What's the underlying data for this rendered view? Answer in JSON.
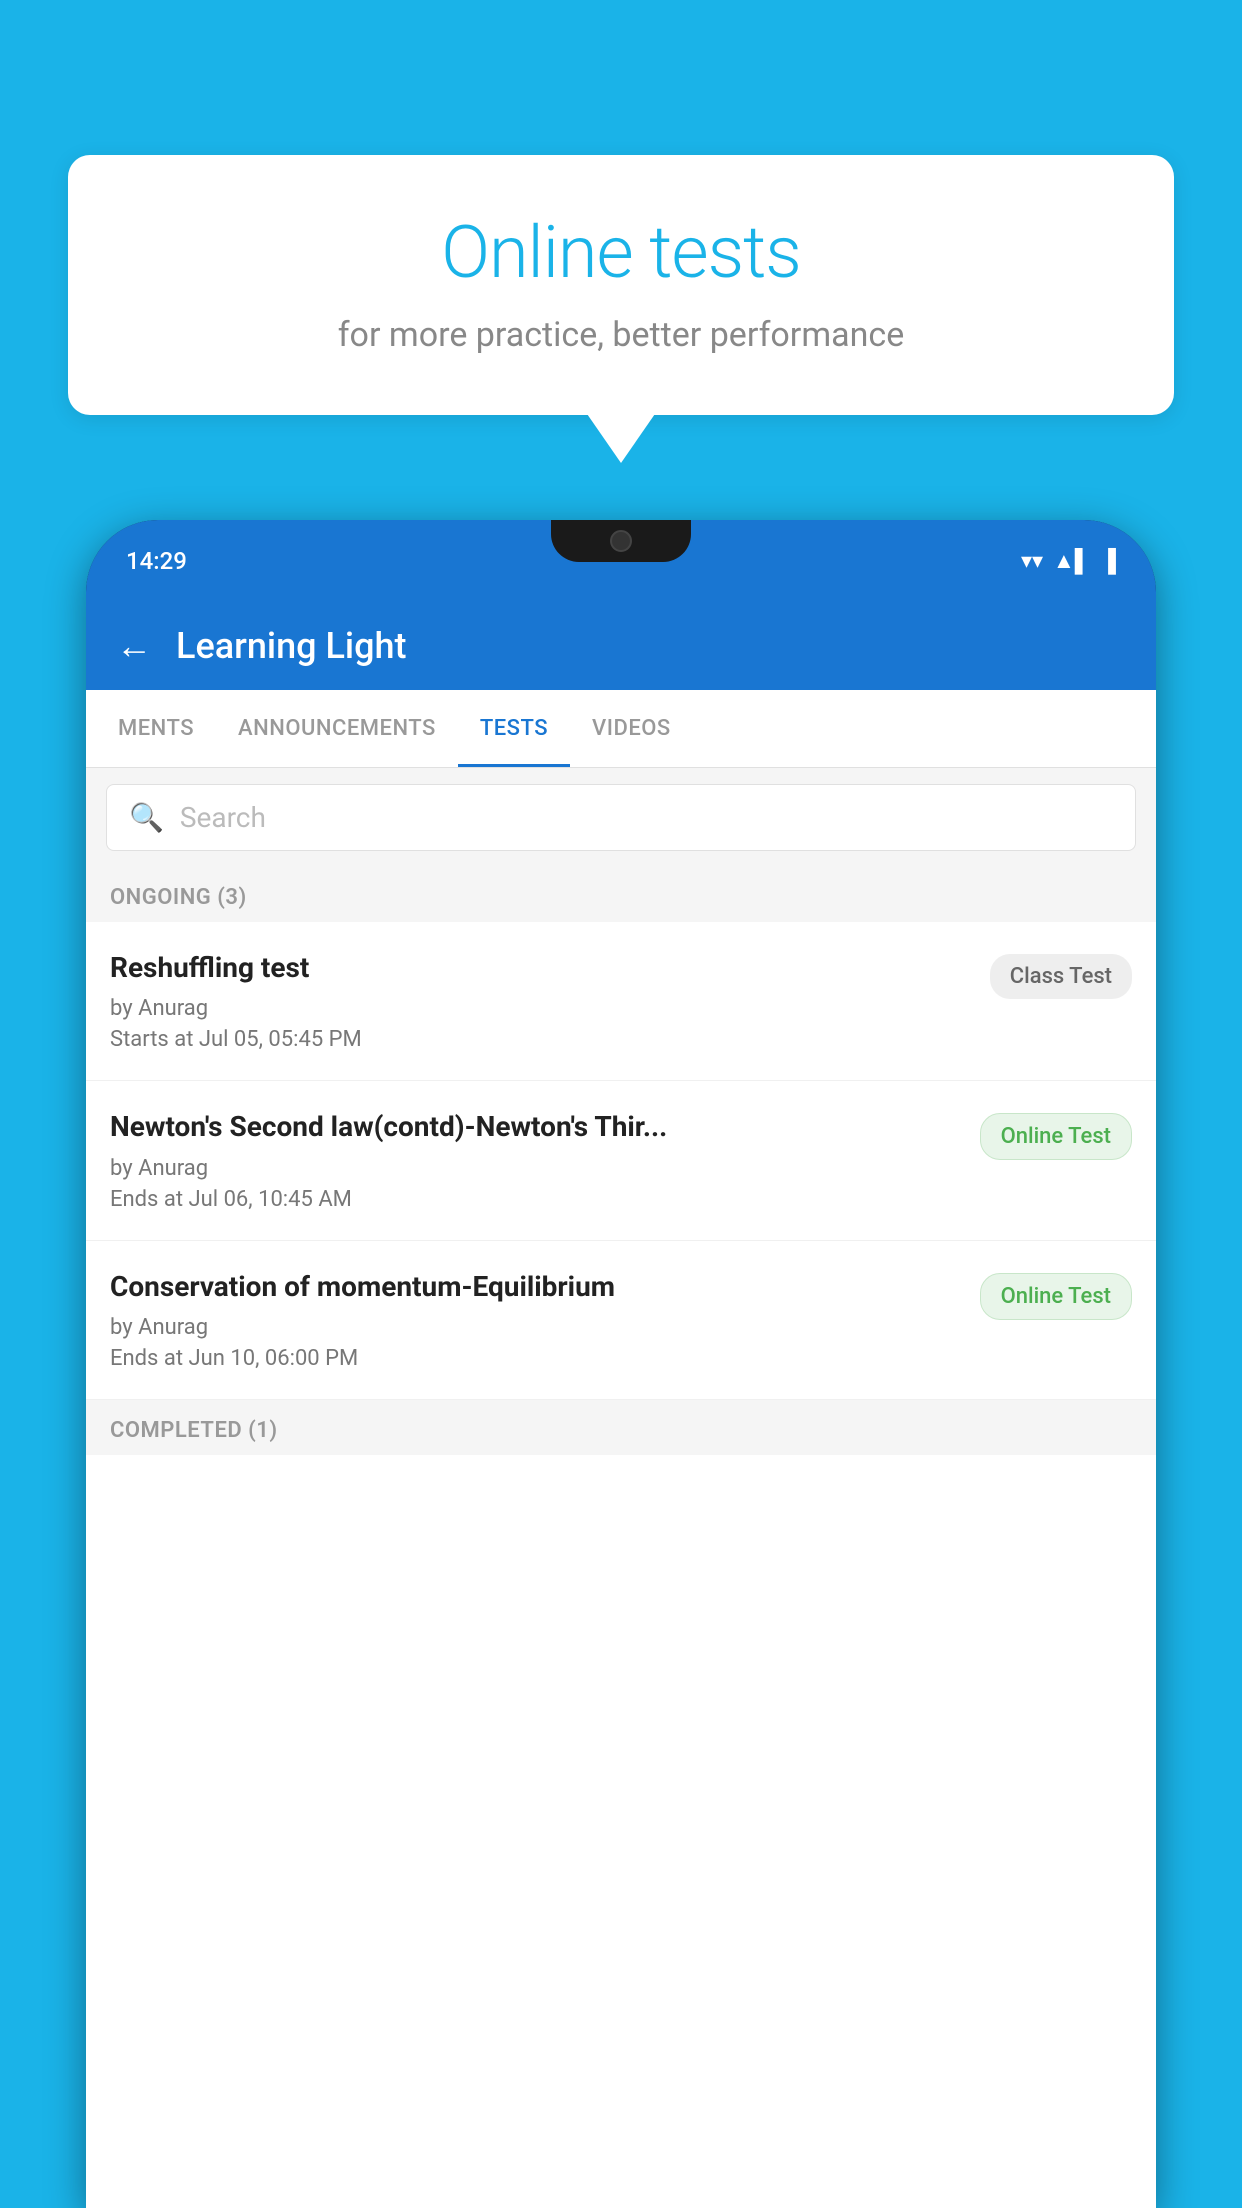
{
  "background_color": "#1ab3e8",
  "speech_bubble": {
    "title": "Online tests",
    "subtitle": "for more practice, better performance"
  },
  "status_bar": {
    "time": "14:29",
    "wifi_icon": "▼",
    "signal_icon": "▲",
    "battery_icon": "▌"
  },
  "app_header": {
    "back_label": "←",
    "title": "Learning Light"
  },
  "tabs": [
    {
      "label": "MENTS",
      "active": false
    },
    {
      "label": "ANNOUNCEMENTS",
      "active": false
    },
    {
      "label": "TESTS",
      "active": true
    },
    {
      "label": "VIDEOS",
      "active": false
    }
  ],
  "search": {
    "placeholder": "Search",
    "icon": "🔍"
  },
  "ongoing_section": {
    "label": "ONGOING (3)"
  },
  "test_items": [
    {
      "title": "Reshuffling test",
      "author": "by Anurag",
      "time": "Starts at  Jul 05, 05:45 PM",
      "badge": "Class Test",
      "badge_type": "class"
    },
    {
      "title": "Newton's Second law(contd)-Newton's Thir...",
      "author": "by Anurag",
      "time": "Ends at  Jul 06, 10:45 AM",
      "badge": "Online Test",
      "badge_type": "online"
    },
    {
      "title": "Conservation of momentum-Equilibrium",
      "author": "by Anurag",
      "time": "Ends at  Jun 10, 06:00 PM",
      "badge": "Online Test",
      "badge_type": "online"
    }
  ],
  "completed_section": {
    "label": "COMPLETED (1)"
  }
}
